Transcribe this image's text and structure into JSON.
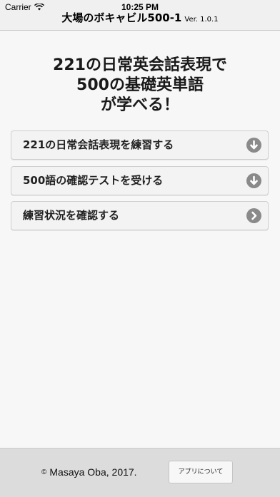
{
  "status_bar": {
    "carrier": "Carrier",
    "time": "10:25 PM"
  },
  "nav": {
    "title": "大場のボキャビル500-1",
    "version": "Ver. 1.0.1"
  },
  "headline": {
    "lines": [
      "221の日常英会話表現で",
      "500の基礎英単語",
      "が学べる！"
    ]
  },
  "menu": {
    "items": [
      {
        "label": "221の日常会話表現を練習する",
        "icon": "arrow-down-circle-icon"
      },
      {
        "label": "500語の確認テストを受ける",
        "icon": "arrow-down-circle-icon"
      },
      {
        "label": "練習状況を確認する",
        "icon": "chevron-right-circle-icon"
      }
    ]
  },
  "footer": {
    "copyright_symbol": "©",
    "copyright_text": "Masaya Oba, 2017.",
    "about_label": "アプリについて"
  },
  "colors": {
    "background": "#f7f7f7",
    "header": "#f0f0f0",
    "footer": "#dcdcdc",
    "icon_circle": "#8a8a8a"
  }
}
